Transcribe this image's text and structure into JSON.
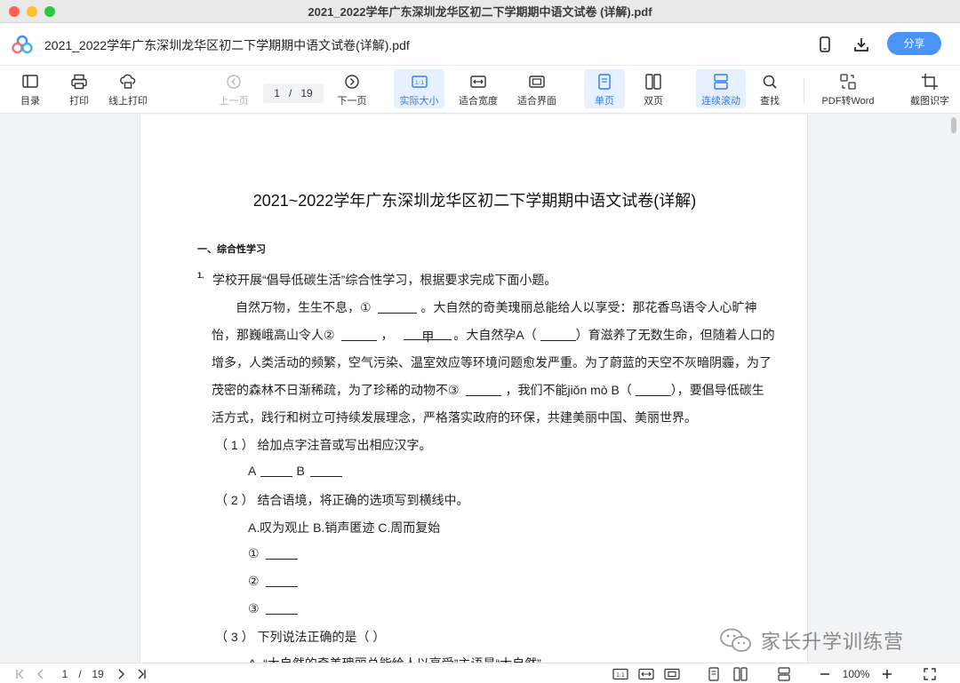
{
  "window": {
    "title": "2021_2022学年广东深圳龙华区初二下学期期中语文试卷 (详解).pdf"
  },
  "header": {
    "file_title": "2021_2022学年广东深圳龙华区初二下学期期中语文试卷(详解).pdf",
    "share_label": "分享",
    "icons": [
      "logo-icon",
      "phone-icon",
      "download-icon"
    ]
  },
  "toolbar": {
    "toc": "目录",
    "print": "打印",
    "online_print": "线上打印",
    "prev": "上一页",
    "next": "下一页",
    "page_current": "1",
    "page_sep": "/",
    "page_total": "19",
    "actual_size": "实际大小",
    "fit_width": "适合宽度",
    "fit_window": "适合界面",
    "single": "单页",
    "double": "双页",
    "continuous": "连续滚动",
    "find": "查找",
    "pdf_to_word": "PDF转Word",
    "ocr": "截图识字"
  },
  "document": {
    "title": "2021~2022学年广东深圳龙华区初二下学期期中语文试卷(详解)",
    "section": "一、综合性学习",
    "qnum": "1.",
    "intro": "学校开展“倡导低碳生活”综合性学习，根据要求完成下面小题。",
    "p1a": "自然万物，生生不息，①",
    "p1b": "。大自然的奇美瑰丽总能给人以享受：那花香鸟语令人心旷神",
    "p2a": "怡，那巍峨高山令人②",
    "p2b": "，",
    "p2jia": "甲",
    "p2c": "。大自然孕A（",
    "p2d": "）育滋养了无数生命，但随着人口的",
    "p3": "增多，人类活动的频繁，空气污染、温室效应等环境问题愈发严重。为了蔚蓝的天空不灰暗阴霾，为了",
    "p4a": "茂密的森林不日渐稀疏，为了珍稀的动物不③",
    "p4b": "，我们不能jiǒn mò B（",
    "p4c": "），要倡导低碳生",
    "p5": "活方式，践行和树立可持续发展理念，严格落实政府的环保，共建美丽中国、美丽世界。",
    "s1": "（ 1 ） 给加点字注音或写出相应汉字。",
    "s1a": "A",
    "s1b": "B",
    "s2": "（ 2 ） 结合语境，将正确的选项写到横线中。",
    "s2opts": "A.叹为观止  B.销声匿迹  C.周而复始",
    "c1": "①",
    "c2": "②",
    "c3": "③",
    "s3": "（ 3 ） 下列说法正确的是（        ）",
    "s3a": "A. “大自然的奇美瑰丽总能给人以享受”主语是“大自然”"
  },
  "watermark": "家长升学训练营",
  "statusbar": {
    "page_current": "1",
    "page_sep": "/",
    "page_total": "19",
    "zoom": "100%"
  }
}
